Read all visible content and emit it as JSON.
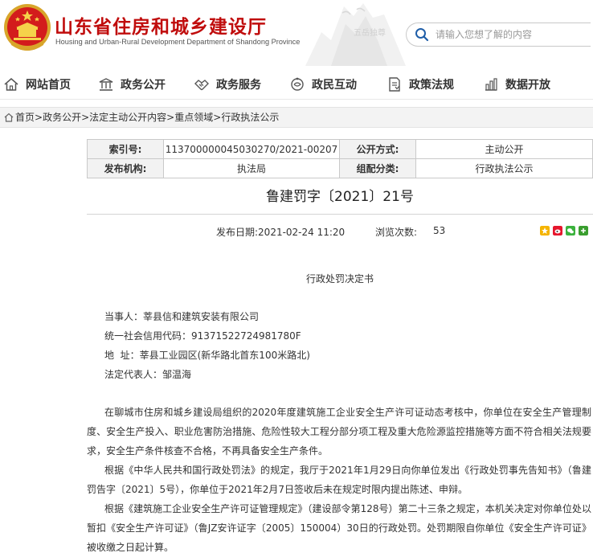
{
  "header": {
    "title": "山东省住房和城乡建设厅",
    "subtitle": "Housing and Urban-Rural Development Department of Shandong Province",
    "search_placeholder": "请输入您想了解的内容",
    "icons": {
      "emblem": "national-emblem-icon",
      "search": "search-icon"
    },
    "colors": {
      "title": "#c00c0c"
    }
  },
  "nav": [
    {
      "label": "网站首页",
      "icon": "home-icon"
    },
    {
      "label": "政务公开",
      "icon": "building-icon"
    },
    {
      "label": "政务服务",
      "icon": "handshake-icon"
    },
    {
      "label": "政民互动",
      "icon": "interaction-icon"
    },
    {
      "label": "政策法规",
      "icon": "document-icon"
    },
    {
      "label": "数据开放",
      "icon": "chart-icon"
    }
  ],
  "breadcrumb": [
    "首页",
    "政务公开",
    "法定主动公开内容",
    "重点领域",
    "行政执法公示"
  ],
  "meta": {
    "index_label": "索引号:",
    "index_value": "113700000045030270/2021-00207",
    "method_label": "公开方式:",
    "method_value": "主动公开",
    "org_label": "发布机构:",
    "org_value": "执法局",
    "category_label": "组配分类:",
    "category_value": "行政执法公示"
  },
  "document": {
    "title": "鲁建罚字〔2021〕21号",
    "publish_date": "发布日期:2021-02-24 11:20",
    "views_label": "浏览次数:",
    "views": "53",
    "share_icons": [
      "qzone-icon",
      "weibo-icon",
      "wechat-icon",
      "more-share-icon"
    ],
    "notice_title": "行政处罚决定书",
    "party": "当事人：莘县信和建筑安装有限公司",
    "credit_code": "统一社会信用代码：91371522724981780F",
    "address": "地  址：莘县工业园区(新华路北首东100米路北)",
    "legal_rep": "法定代表人：邹温海",
    "paragraphs": [
      "在聊城市住房和城乡建设局组织的2020年度建筑施工企业安全生产许可证动态考核中，你单位在安全生产管理制度、安全生产投入、职业危害防治措施、危险性较大工程分部分项工程及重大危险源监控措施等方面不符合相关法规要求，安全生产条件核查不合格，不再具备安全生产条件。",
      "根据《中华人民共和国行政处罚法》的规定，我厅于2021年1月29日向你单位发出《行政处罚事先告知书》（鲁建罚告字〔2021〕5号），你单位于2021年2月7日签收后未在规定时限内提出陈述、申辩。",
      "根据《建筑施工企业安全生产许可证管理规定》（建设部令第128号）第二十三条之规定，本机关决定对你单位处以暂扣《安全生产许可证》（鲁JZ安许证字〔2005〕150004）30日的行政处罚。处罚期限自你单位《安全生产许可证》被收缴之日起计算。"
    ]
  }
}
